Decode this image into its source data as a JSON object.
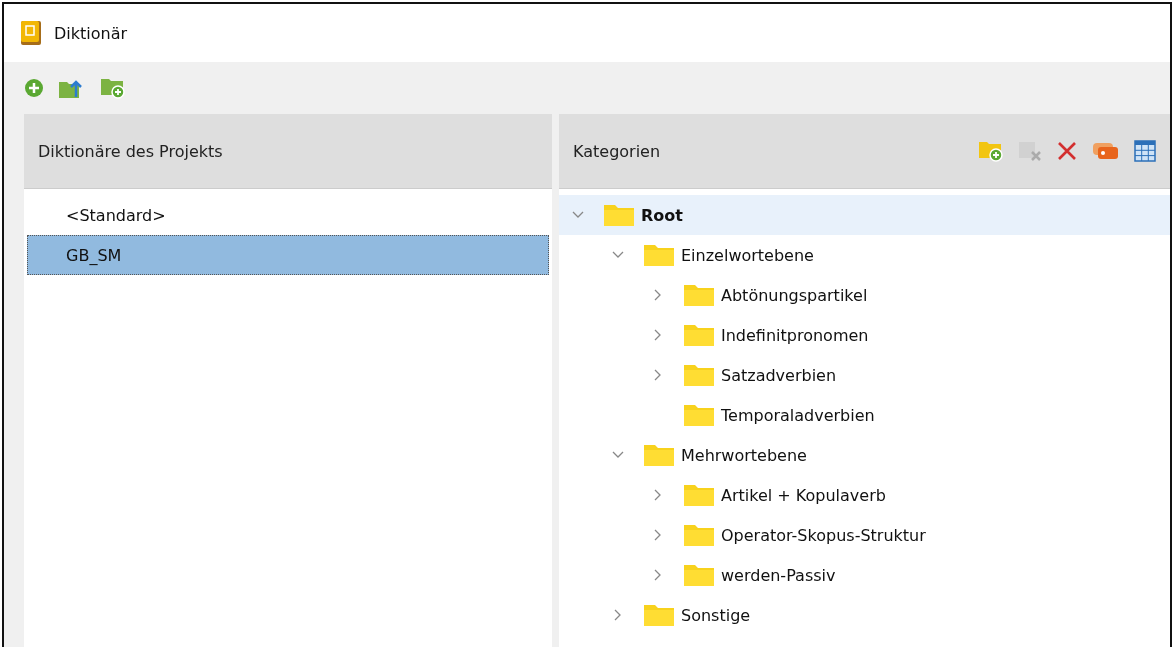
{
  "window": {
    "title": "Diktionär"
  },
  "toolbar": [
    {
      "kind": "add"
    },
    {
      "kind": "export"
    },
    {
      "kind": "new-folder"
    }
  ],
  "dictionaries": {
    "header": "Diktionäre des Projekts",
    "items": [
      {
        "label": "<Standard>",
        "selected": false
      },
      {
        "label": "GB_SM",
        "selected": true
      }
    ]
  },
  "categories": {
    "header": "Kategorien",
    "tools": [
      {
        "kind": "new-folder",
        "disabled": false
      },
      {
        "kind": "delete-table",
        "disabled": true
      },
      {
        "kind": "delete",
        "disabled": false
      },
      {
        "kind": "tag",
        "disabled": false
      },
      {
        "kind": "table",
        "disabled": false
      }
    ],
    "tree": [
      {
        "label": "Root",
        "selected": true,
        "expandable": true,
        "expanded": true,
        "children": [
          {
            "label": "Einzelwortebene",
            "selected": false,
            "expandable": true,
            "expanded": true,
            "children": [
              {
                "label": "Abtönungspartikel",
                "selected": false,
                "expandable": true,
                "expanded": false
              },
              {
                "label": "Indefinitpronomen",
                "selected": false,
                "expandable": true,
                "expanded": false
              },
              {
                "label": "Satzadverbien",
                "selected": false,
                "expandable": true,
                "expanded": false
              },
              {
                "label": "Temporaladverbien",
                "selected": false,
                "expandable": false,
                "expanded": false
              }
            ]
          },
          {
            "label": "Mehrwortebene",
            "selected": false,
            "expandable": true,
            "expanded": true,
            "children": [
              {
                "label": "Artikel + Kopulaverb",
                "selected": false,
                "expandable": true,
                "expanded": false
              },
              {
                "label": "Operator-Skopus-Struktur",
                "selected": false,
                "expandable": true,
                "expanded": false
              },
              {
                "label": "werden-Passiv",
                "selected": false,
                "expandable": true,
                "expanded": false
              }
            ]
          },
          {
            "label": "Sonstige",
            "selected": false,
            "expandable": true,
            "expanded": false
          }
        ]
      }
    ]
  }
}
